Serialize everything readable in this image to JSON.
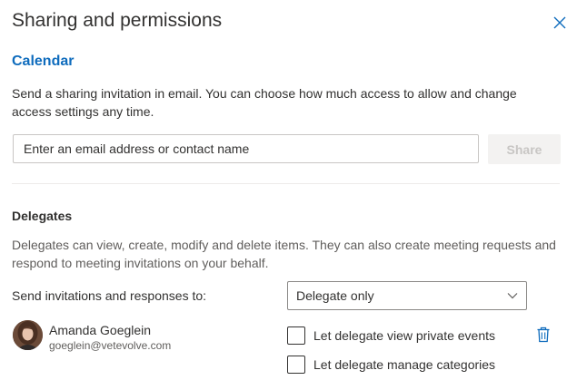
{
  "dialog": {
    "title": "Sharing and permissions",
    "close_icon": "close-icon"
  },
  "calendar": {
    "title": "Calendar",
    "intro": "Send a sharing invitation in email. You can choose how much access to allow and change access settings any time.",
    "email_placeholder": "Enter an email address or contact name",
    "email_value": "",
    "share_label": "Share"
  },
  "delegates": {
    "heading": "Delegates",
    "description": "Delegates can view, create, modify and delete items. They can also create meeting requests and respond to meeting invitations on your behalf.",
    "send_label": "Send invitations and responses to:",
    "send_selected": "Delegate only",
    "delegate": {
      "name": "Amanda Goeglein",
      "email": "goeglein@vetevolve.com",
      "view_private_label": "Let delegate view private events",
      "view_private_checked": false,
      "manage_categories_label": "Let delegate manage categories",
      "manage_categories_checked": false,
      "delete_icon": "trash-icon"
    }
  },
  "colors": {
    "accent": "#0f6cbd",
    "text": "#323130",
    "secondary_text": "#605e5c",
    "disabled_bg": "#f3f2f1",
    "disabled_text": "#c8c6c4"
  }
}
